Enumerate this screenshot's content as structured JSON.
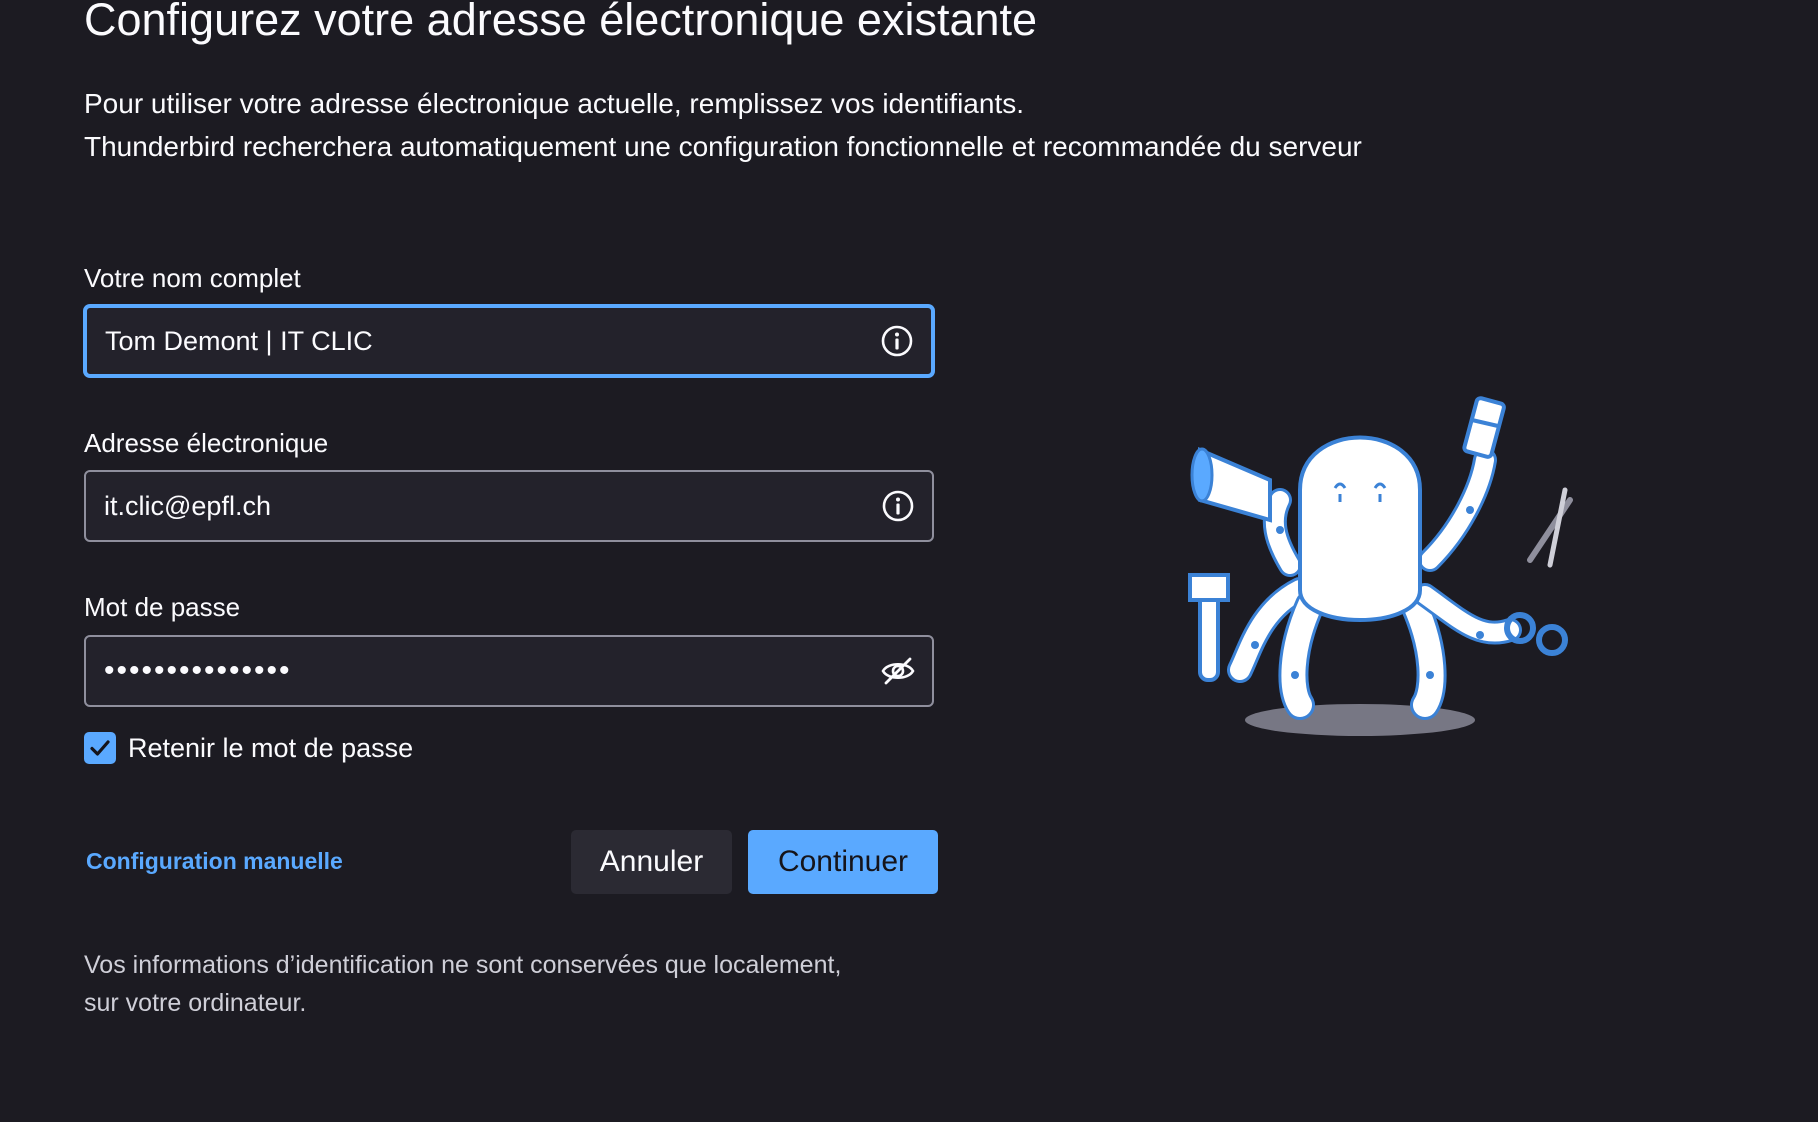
{
  "header": {
    "title": "Configurez votre adresse électronique existante",
    "intro_line1": "Pour utiliser votre adresse électronique actuelle, remplissez vos identifiants.",
    "intro_line2": "Thunderbird recherchera automatiquement une configuration fonctionnelle et recommandée du serveur"
  },
  "form": {
    "name": {
      "label": "Votre nom complet",
      "value": "Tom Demont | IT CLIC",
      "icon": "info-icon"
    },
    "email": {
      "label": "Adresse électronique",
      "value": "it.clic@epfl.ch",
      "icon": "info-icon"
    },
    "password": {
      "label": "Mot de passe",
      "value": "•••••••••••••••",
      "icon": "eye-slash-icon"
    },
    "remember": {
      "label": "Retenir le mot de passe",
      "checked": true
    }
  },
  "actions": {
    "manual_config": "Configuration manuelle",
    "cancel": "Annuler",
    "continue": "Continuer"
  },
  "footer": {
    "line1": "Vos informations d’identification ne sont conservées que localement,",
    "line2": "sur votre ordinateur."
  },
  "colors": {
    "background": "#1c1b22",
    "field_bg": "#23222b",
    "accent": "#5aa9ff",
    "text": "#fbfbfe",
    "muted": "#cfcfd8"
  }
}
